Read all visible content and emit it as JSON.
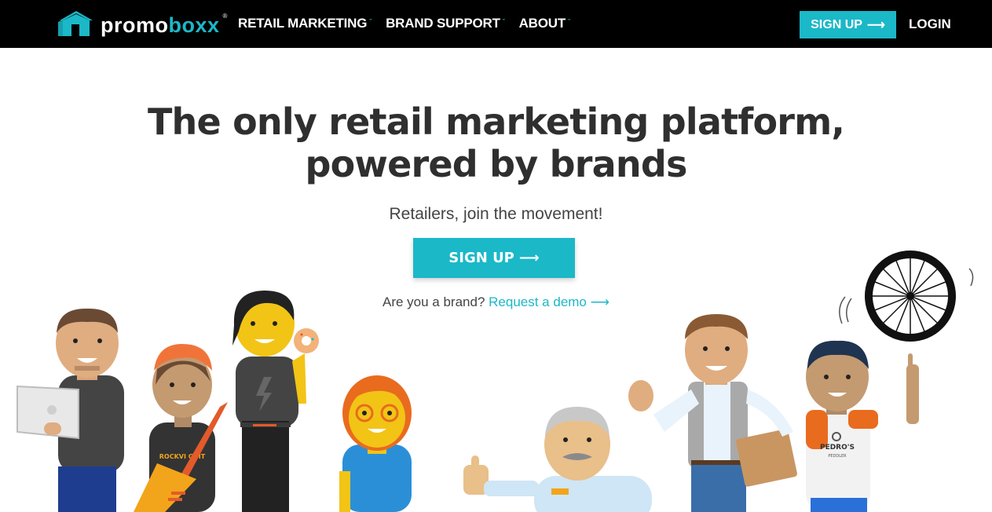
{
  "nav": {
    "logo_prefix": "promo",
    "logo_accent": "boxx",
    "logo_tm": "®",
    "menu": [
      {
        "label": "RETAIL MARKETING"
      },
      {
        "label": "BRAND SUPPORT"
      },
      {
        "label": "ABOUT"
      }
    ],
    "signup_label": "SIGN UP",
    "login_label": "LOGIN"
  },
  "hero": {
    "title_line1": "The only retail marketing platform,",
    "title_line2": "powered by brands",
    "subtitle": "Retailers, join the movement!",
    "signup_label": "SIGN UP",
    "brand_question": "Are you a brand?",
    "demo_link": "Request a demo"
  },
  "illustration": {
    "guitar_shirt_text": "ROCKVI GUIT",
    "shop_shirt_line1": "PEDRO'S",
    "shop_shirt_line2": "PEDDLER"
  },
  "colors": {
    "brand": "#1bb8c8",
    "nav_bg": "#000000",
    "heading": "#2f2f2f",
    "body_text": "#444444"
  },
  "icons": [
    "house-logo-icon",
    "chevron-down-icon",
    "arrow-right-icon"
  ]
}
